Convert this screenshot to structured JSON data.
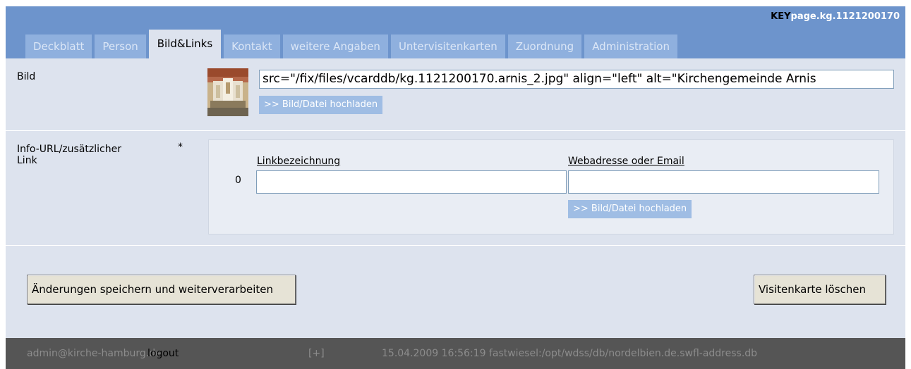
{
  "header": {
    "key_prefix": "KEY",
    "key_value": "page.kg.1121200170"
  },
  "tabs": [
    {
      "label": "Deckblatt",
      "active": false
    },
    {
      "label": "Person",
      "active": false
    },
    {
      "label": "Bild&Links",
      "active": true
    },
    {
      "label": "Kontakt",
      "active": false
    },
    {
      "label": "weitere Angaben",
      "active": false
    },
    {
      "label": "Untervisitenkarten",
      "active": false
    },
    {
      "label": "Zuordnung",
      "active": false
    },
    {
      "label": "Administration",
      "active": false
    }
  ],
  "bild": {
    "label": "Bild",
    "src_value": "src=\"/fix/files/vcarddb/kg.1121200170.arnis_2.jpg\" align=\"left\" alt=\"Kirchengemeinde Arnis",
    "upload_label": ">> Bild/Datei hochladen"
  },
  "link_section": {
    "label_line1": "Info-URL/zusätzlicher",
    "label_line2": "Link",
    "required_marker": "*",
    "row_index": "0",
    "col_name": "Linkbezeichnung",
    "col_url": "Webadresse oder Email",
    "name_value": "",
    "url_value": "",
    "upload_label": ">> Bild/Datei hochladen"
  },
  "actions": {
    "save_label": "Änderungen speichern und weiterverarbeiten",
    "delete_label": "Visitenkarte löschen"
  },
  "footer": {
    "user": "admin@kirche-hamburg.de",
    "logout": "logout",
    "expand": "[+]",
    "info": "15.04.2009 16:56:19 fastwiesel:/opt/wdss/db/nordelbien.de.swfl-address.db"
  }
}
